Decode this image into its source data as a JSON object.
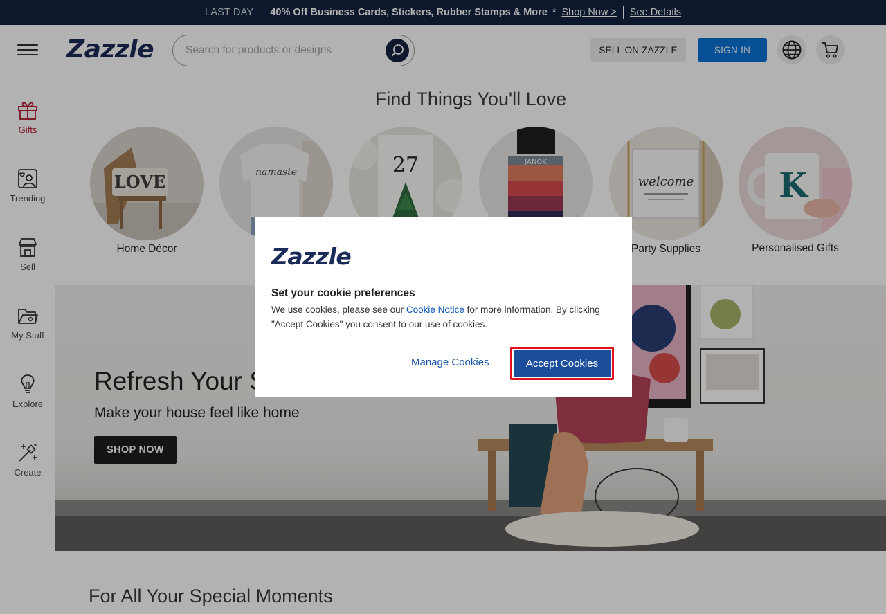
{
  "promo": {
    "last_day": "LAST DAY",
    "offer": "40% Off Business Cards, Stickers, Rubber Stamps & More",
    "star": "*",
    "shop_now": "Shop Now >",
    "see_details": "See Details"
  },
  "sidebar": {
    "items": [
      {
        "label": "Gifts",
        "icon": "gift-icon",
        "active": true
      },
      {
        "label": "Trending",
        "icon": "trending-icon"
      },
      {
        "label": "Sell",
        "icon": "store-icon"
      },
      {
        "label": "My Stuff",
        "icon": "folder-icon"
      },
      {
        "label": "Explore",
        "icon": "lightbulb-icon"
      },
      {
        "label": "Create",
        "icon": "magic-wand-icon"
      }
    ]
  },
  "header": {
    "logo": "Zazzle",
    "search_placeholder": "Search for products or designs",
    "sell_button": "SELL ON ZAZZLE",
    "signin_button": "SIGN IN",
    "icons": [
      "globe-icon",
      "cart-icon"
    ]
  },
  "main": {
    "section_title": "Find Things You'll Love",
    "categories": [
      {
        "label": "Home Décor",
        "image_text": "LOVE"
      },
      {
        "label": "",
        "image_text": "namaste"
      },
      {
        "label": "",
        "image_text": "27"
      },
      {
        "label": "",
        "image_text": "JANOK"
      },
      {
        "label": "Party Supplies",
        "image_text": "welcome"
      },
      {
        "label": "Personalised Gifts",
        "image_text": "K"
      }
    ],
    "hero": {
      "title": "Refresh Your S",
      "subtitle": "Make your house feel like home",
      "button": "SHOP NOW"
    },
    "moments_title": "For All Your Special Moments"
  },
  "cookie_modal": {
    "logo": "Zazzle",
    "title": "Set your cookie preferences",
    "text_before": "We use cookies, please see our ",
    "link": "Cookie Notice",
    "text_after": " for more information. By clicking \"Accept Cookies\" you consent to our use of cookies.",
    "manage": "Manage Cookies",
    "accept": "Accept Cookies"
  },
  "colors": {
    "navy": "#14233f",
    "brand_blue": "#1a2b57",
    "signin_blue": "#0b73d6",
    "accept_blue": "#1a4d9c",
    "highlight_red": "#e0111e",
    "gifts_red": "#b1132f"
  }
}
